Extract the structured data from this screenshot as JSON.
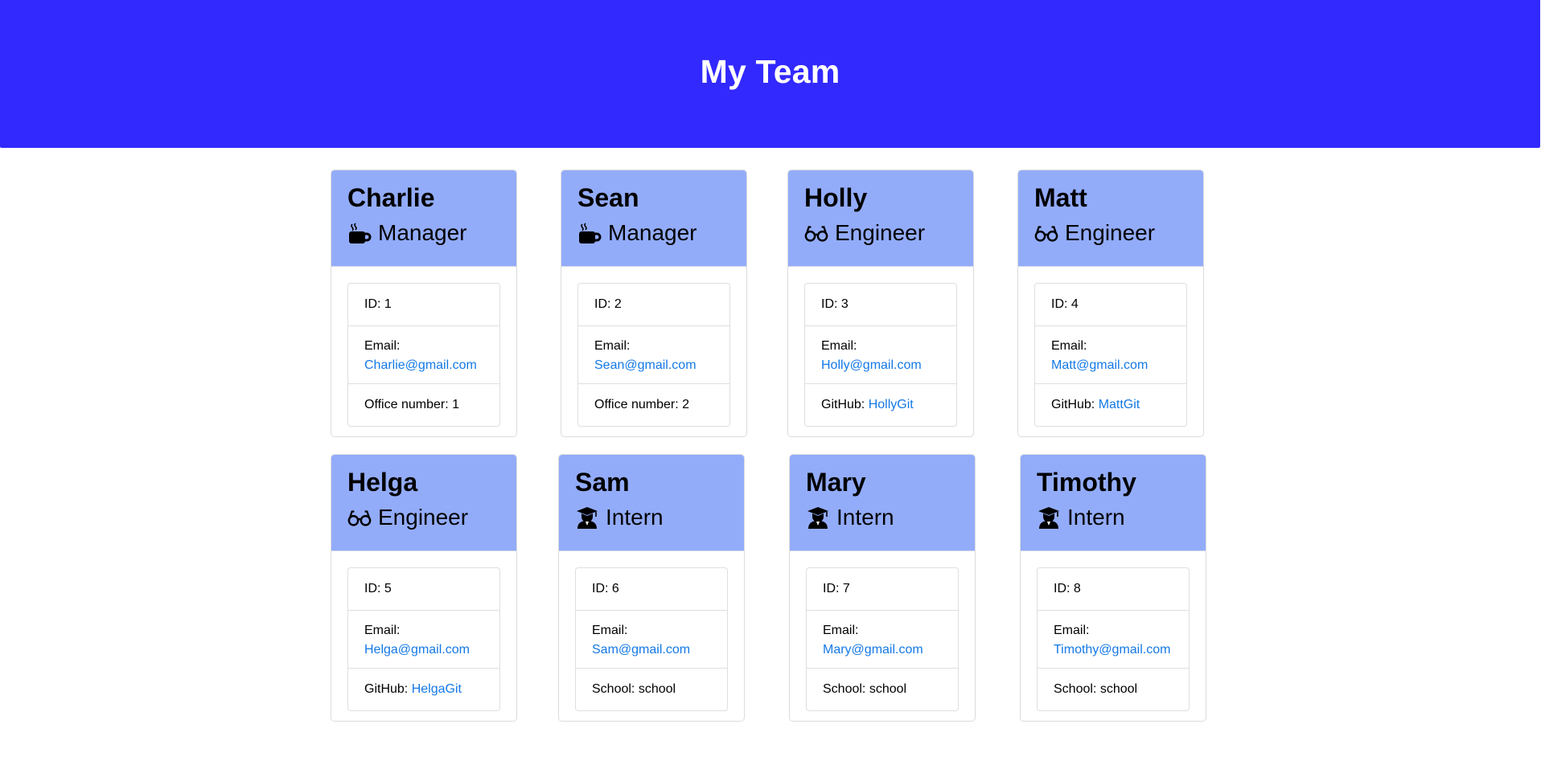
{
  "header": {
    "title": "My Team"
  },
  "colors": {
    "header_bg": "#3229ff",
    "card_header_bg": "#93acfa",
    "link": "#1479e6"
  },
  "members": [
    {
      "name": "Charlie",
      "role": "Manager",
      "icon": "coffee-mug-icon",
      "id_label": "ID: 1",
      "email_label": "Email:",
      "email": "Charlie@gmail.com",
      "extra_label": "Office number: 1",
      "extra_link": ""
    },
    {
      "name": "Sean",
      "role": "Manager",
      "icon": "coffee-mug-icon",
      "id_label": "ID: 2",
      "email_label": "Email:",
      "email": "Sean@gmail.com",
      "extra_label": "Office number: 2",
      "extra_link": ""
    },
    {
      "name": "Holly",
      "role": "Engineer",
      "icon": "glasses-icon",
      "id_label": "ID: 3",
      "email_label": "Email:",
      "email": "Holly@gmail.com",
      "extra_label": "GitHub: ",
      "extra_link": "HollyGit"
    },
    {
      "name": "Matt",
      "role": "Engineer",
      "icon": "glasses-icon",
      "id_label": "ID: 4",
      "email_label": "Email:",
      "email": "Matt@gmail.com",
      "extra_label": "GitHub: ",
      "extra_link": "MattGit"
    },
    {
      "name": "Helga",
      "role": "Engineer",
      "icon": "glasses-icon",
      "id_label": "ID: 5",
      "email_label": "Email:",
      "email": "Helga@gmail.com",
      "extra_label": "GitHub: ",
      "extra_link": "HelgaGit"
    },
    {
      "name": "Sam",
      "role": "Intern",
      "icon": "graduate-icon",
      "id_label": "ID: 6",
      "email_label": "Email:",
      "email": "Sam@gmail.com",
      "extra_label": "School: school",
      "extra_link": ""
    },
    {
      "name": "Mary",
      "role": "Intern",
      "icon": "graduate-icon",
      "id_label": "ID: 7",
      "email_label": "Email:",
      "email": "Mary@gmail.com",
      "extra_label": "School: school",
      "extra_link": ""
    },
    {
      "name": "Timothy",
      "role": "Intern",
      "icon": "graduate-icon",
      "id_label": "ID: 8",
      "email_label": "Email:",
      "email": "Timothy@gmail.com",
      "extra_label": "School: school",
      "extra_link": ""
    }
  ]
}
